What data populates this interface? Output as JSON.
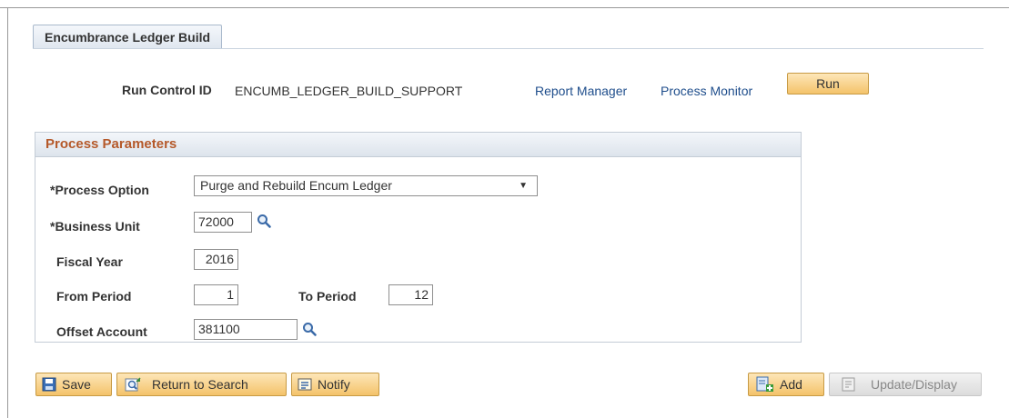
{
  "tab": {
    "label": "Encumbrance Ledger Build"
  },
  "header": {
    "run_control_label": "Run Control ID",
    "run_control_value": "ENCUMB_LEDGER_BUILD_SUPPORT",
    "report_manager": "Report Manager",
    "process_monitor": "Process Monitor",
    "run_button": "Run"
  },
  "process_parameters": {
    "title": "Process Parameters",
    "process_option_label": "*Process Option",
    "process_option_value": "Purge and Rebuild Encum Ledger",
    "business_unit_label": "*Business Unit",
    "business_unit_value": "72000",
    "fiscal_year_label": "Fiscal Year",
    "fiscal_year_value": "2016",
    "from_period_label": "From Period",
    "from_period_value": "1",
    "to_period_label": "To Period",
    "to_period_value": "12",
    "offset_account_label": "Offset Account",
    "offset_account_value": "381100"
  },
  "toolbar": {
    "save": "Save",
    "return_to_search": "Return to Search",
    "notify": "Notify",
    "add": "Add",
    "update_display": "Update/Display"
  },
  "icons": {
    "lookup": "magnifier-icon",
    "save": "floppy-disk-icon",
    "return_to_search": "search-return-icon",
    "notify": "notify-icon",
    "add": "add-document-icon",
    "update_display": "update-display-icon"
  }
}
